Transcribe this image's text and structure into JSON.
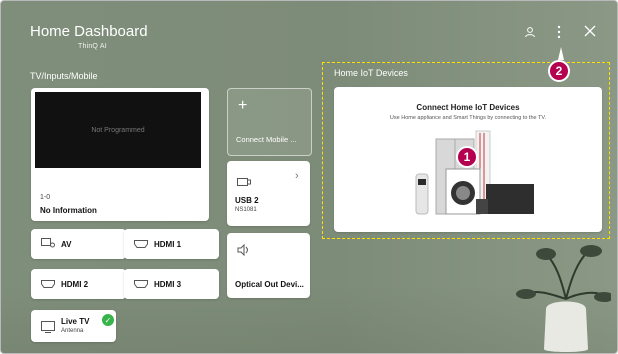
{
  "header": {
    "title": "Home Dashboard",
    "brand": "ThinQ AI",
    "profile_icon": "profile-icon",
    "more_icon": "more-vertical-icon",
    "close_icon": "close-icon"
  },
  "sections": {
    "tv_inputs_mobile": "TV/Inputs/Mobile",
    "home_iot": "Home IoT Devices"
  },
  "preview": {
    "screen_text": "Not Programmed",
    "channel": "1-0",
    "info": "No Information"
  },
  "connect_mobile": {
    "icon": "plus-icon",
    "label": "Connect Mobile ..."
  },
  "usb": {
    "icon": "usb-icon",
    "label": "USB 2",
    "sublabel": "NS1081",
    "chevron": "chevron-right-icon"
  },
  "optical": {
    "icon": "speaker-icon",
    "label": "Optical Out Devi..."
  },
  "inputs": [
    {
      "label": "AV",
      "icon": "av-icon"
    },
    {
      "label": "HDMI 1",
      "icon": "hdmi-icon"
    },
    {
      "label": "HDMI 2",
      "icon": "hdmi-icon"
    },
    {
      "label": "HDMI 3",
      "icon": "hdmi-icon"
    }
  ],
  "live_tv": {
    "label": "Live TV",
    "sublabel": "Antenna",
    "icon": "tv-icon",
    "status_icon": "check-icon"
  },
  "iot_card": {
    "title": "Connect Home IoT Devices",
    "subtitle": "Use Home appliance and Smart Things by connecting to the TV."
  },
  "badges": {
    "one": "1",
    "two": "2"
  },
  "colors": {
    "accent_badge": "#b4004e",
    "dashed_highlight": "#ffe100",
    "background": "#7f8e7a",
    "check": "#37b44a"
  }
}
